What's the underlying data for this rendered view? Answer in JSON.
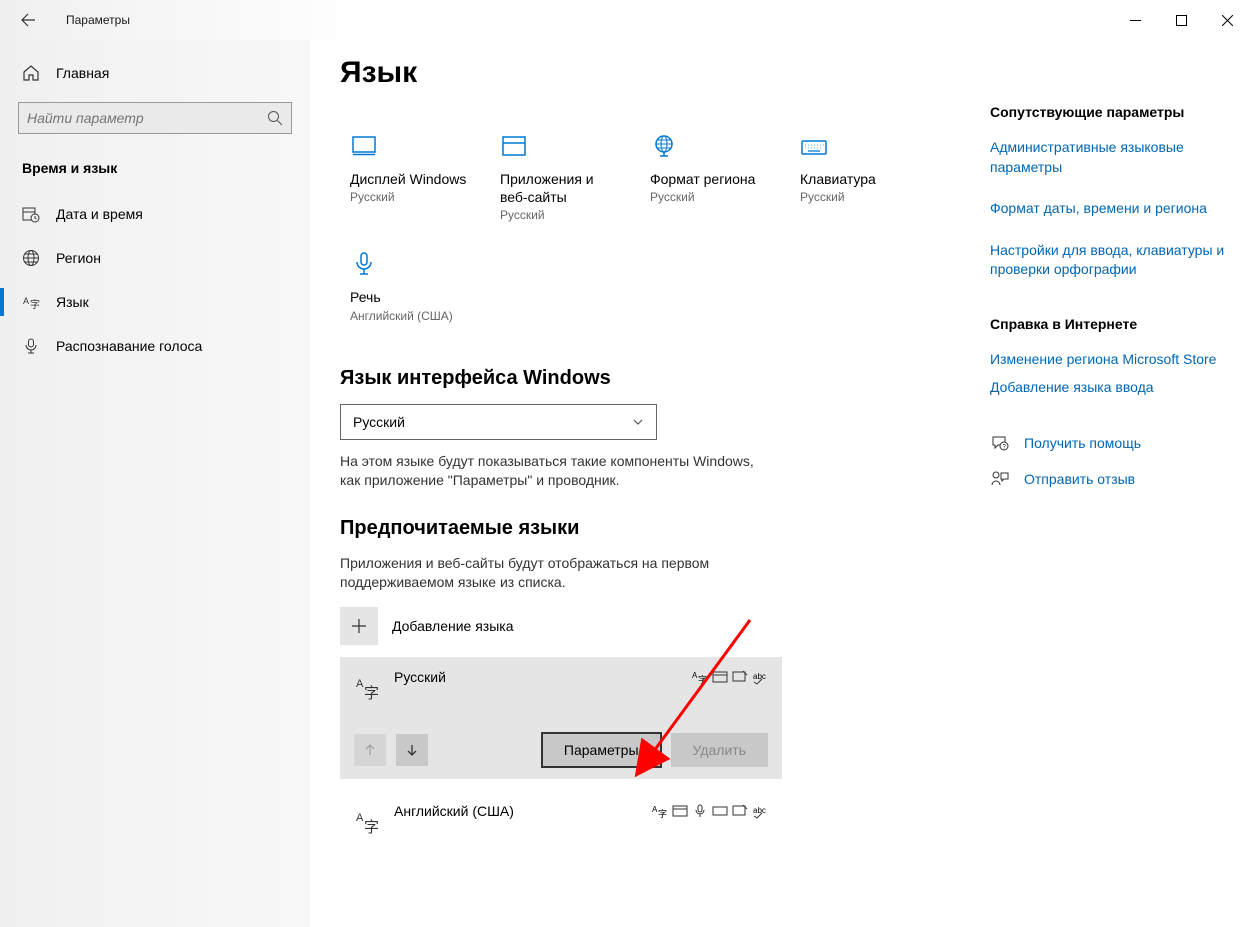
{
  "window": {
    "title": "Параметры"
  },
  "sidebar": {
    "home": "Главная",
    "search_placeholder": "Найти параметр",
    "category": "Время и язык",
    "items": [
      {
        "label": "Дата и время"
      },
      {
        "label": "Регион"
      },
      {
        "label": "Язык"
      },
      {
        "label": "Распознавание голоса"
      }
    ]
  },
  "page": {
    "title": "Язык",
    "tiles": [
      {
        "label": "Дисплей Windows",
        "sub": "Русский"
      },
      {
        "label": "Приложения и веб-сайты",
        "sub": "Русский"
      },
      {
        "label": "Формат региона",
        "sub": "Русский"
      },
      {
        "label": "Клавиатура",
        "sub": "Русский"
      },
      {
        "label": "Речь",
        "sub": "Английский (США)"
      }
    ],
    "display_lang": {
      "title": "Язык интерфейса Windows",
      "selected": "Русский",
      "desc": "На этом языке будут показываться такие компоненты Windows, как приложение \"Параметры\" и проводник."
    },
    "preferred": {
      "title": "Предпочитаемые языки",
      "desc": "Приложения и веб-сайты будут отображаться на первом поддерживаемом языке из списка.",
      "add": "Добавление языка",
      "items": [
        {
          "name": "Русский"
        },
        {
          "name": "Английский (США)"
        }
      ],
      "btn_options": "Параметры",
      "btn_remove": "Удалить"
    }
  },
  "aside": {
    "related_title": "Сопутствующие параметры",
    "links": [
      "Административные языковые параметры",
      "Формат даты, времени и региона",
      "Настройки для ввода, клавиатуры и проверки орфографии"
    ],
    "help_title": "Справка в Интернете",
    "help_links": [
      "Изменение региона Microsoft Store",
      "Добавление языка ввода"
    ],
    "get_help": "Получить помощь",
    "feedback": "Отправить отзыв"
  }
}
